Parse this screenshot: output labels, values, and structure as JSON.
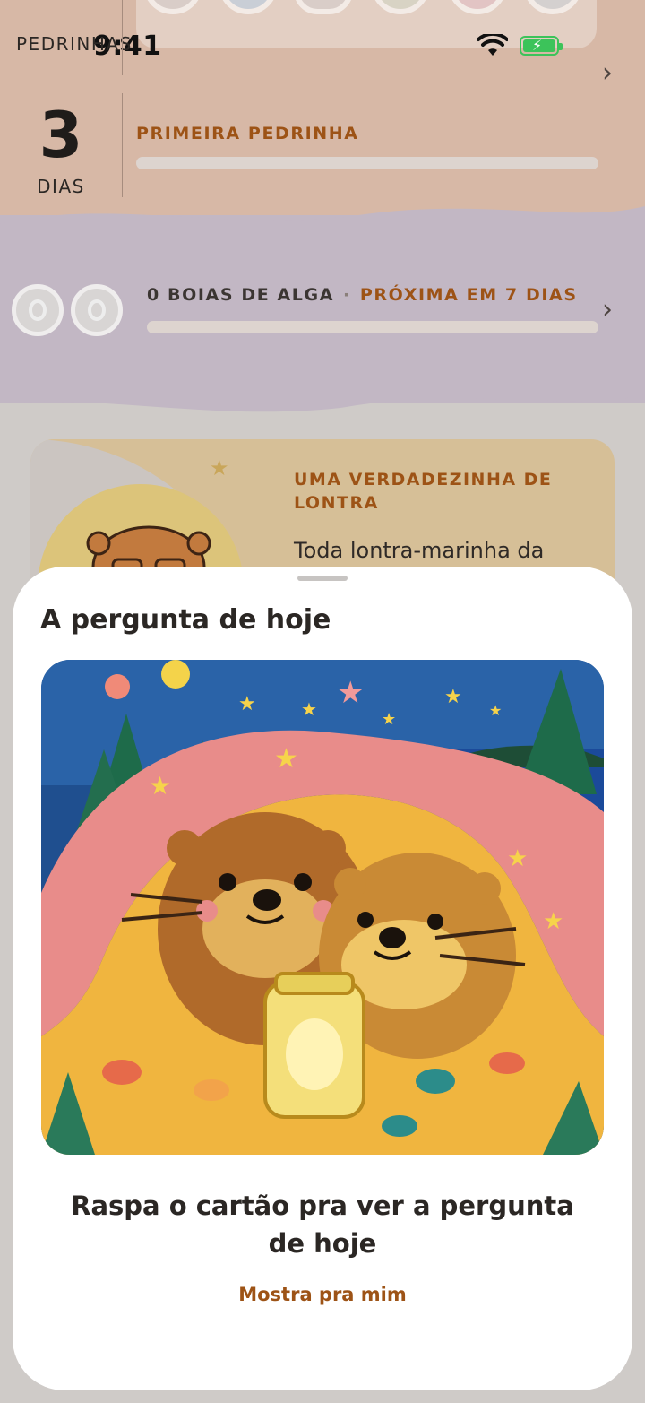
{
  "status_bar": {
    "time": "9:41"
  },
  "stats": {
    "pebbles_label": "PEDRINHAS",
    "days_value": "3",
    "days_label": "DIAS",
    "goal_label": "PRIMEIRA PEDRINHA",
    "goal_progress": 0
  },
  "boias": {
    "count_text": "0 BOIAS DE ALGA",
    "separator": "·",
    "next_text": "PRÓXIMA EM 7 DIAS",
    "progress": 0
  },
  "fact_card": {
    "title": "UMA VERDADEZINHA DE LONTRA",
    "text": "Toda lontra-marinha da"
  },
  "sheet": {
    "title": "A pergunta de hoje",
    "prompt": "Raspa o cartão pra ver a pergunta de hoje",
    "reveal_link": "Mostra pra mim"
  },
  "colors": {
    "accent": "#9d5316",
    "battery": "#3cc35a",
    "top_band": "#d7b8a6",
    "mid_band": "#c2b7c4"
  }
}
